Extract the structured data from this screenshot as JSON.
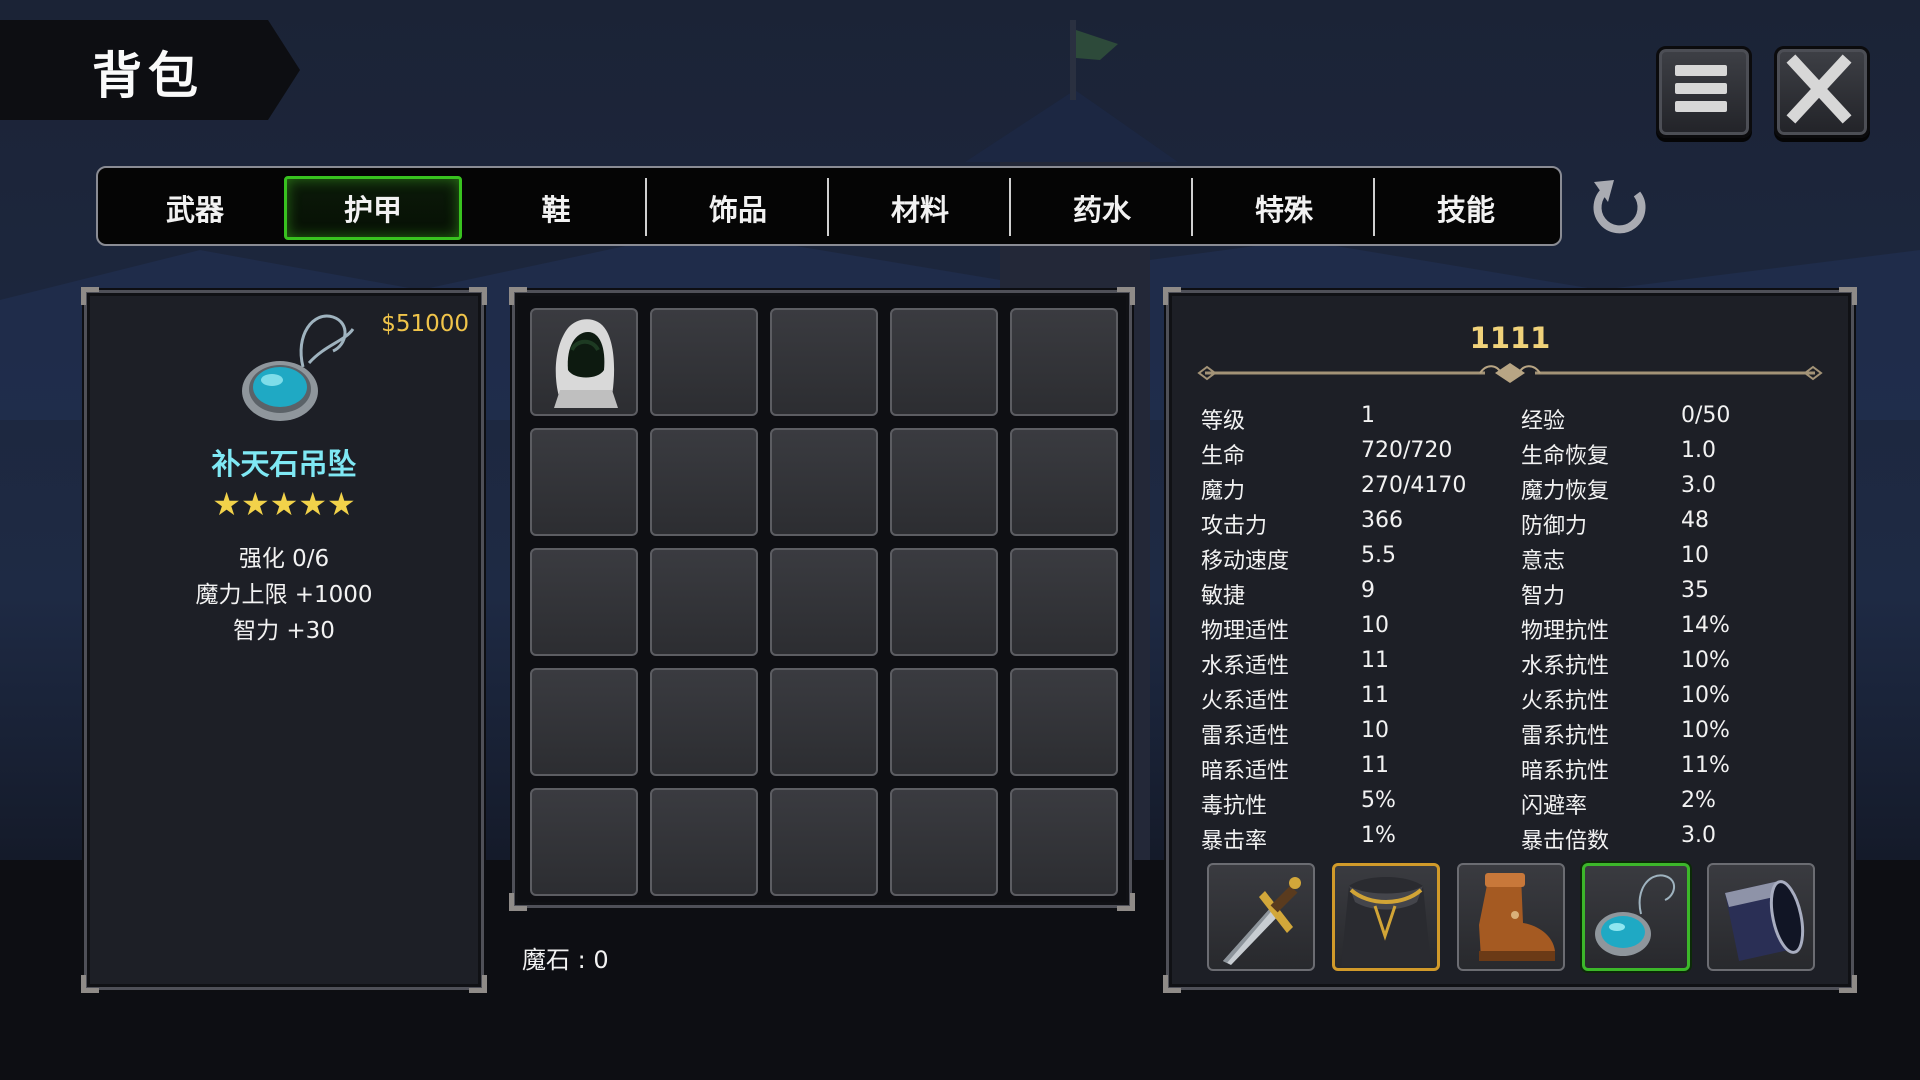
{
  "header": {
    "title": "背包"
  },
  "tabs": [
    {
      "label": "武器",
      "active": false
    },
    {
      "label": "护甲",
      "active": true
    },
    {
      "label": "鞋",
      "active": false
    },
    {
      "label": "饰品",
      "active": false
    },
    {
      "label": "材料",
      "active": false
    },
    {
      "label": "药水",
      "active": false
    },
    {
      "label": "特殊",
      "active": false
    },
    {
      "label": "技能",
      "active": false
    }
  ],
  "selected_item": {
    "price": "$51000",
    "name": "补天石吊坠",
    "stars": "★★★★★",
    "icon": "turquoise-pendant-icon",
    "lines": [
      "强化 0/6",
      "魔力上限  +1000",
      "智力  +30"
    ]
  },
  "inventory": {
    "columns": 5,
    "rows": 5,
    "items": [
      {
        "slot": 0,
        "icon": "white-hood-icon"
      }
    ],
    "magic_stone_label": "魔石 : 0"
  },
  "character": {
    "name": "1111",
    "stats_left": [
      {
        "label": "等级",
        "value": "1"
      },
      {
        "label": "生命",
        "value": "720/720"
      },
      {
        "label": "魔力",
        "value": "270/4170"
      },
      {
        "label": "攻击力",
        "value": "366"
      },
      {
        "label": "移动速度",
        "value": "5.5"
      },
      {
        "label": "敏捷",
        "value": "9"
      },
      {
        "label": "物理适性",
        "value": "10"
      },
      {
        "label": "水系适性",
        "value": "11"
      },
      {
        "label": "火系适性",
        "value": "11"
      },
      {
        "label": "雷系适性",
        "value": "10"
      },
      {
        "label": "暗系适性",
        "value": "11"
      },
      {
        "label": "毒抗性",
        "value": "5%"
      },
      {
        "label": "暴击率",
        "value": "1%"
      }
    ],
    "stats_right": [
      {
        "label": "经验",
        "value": "0/50"
      },
      {
        "label": "生命恢复",
        "value": "1.0"
      },
      {
        "label": "魔力恢复",
        "value": "3.0"
      },
      {
        "label": "防御力",
        "value": "48"
      },
      {
        "label": "意志",
        "value": "10"
      },
      {
        "label": "智力",
        "value": "35"
      },
      {
        "label": "物理抗性",
        "value": "14%"
      },
      {
        "label": "水系抗性",
        "value": "10%"
      },
      {
        "label": "火系抗性",
        "value": "10%"
      },
      {
        "label": "雷系抗性",
        "value": "10%"
      },
      {
        "label": "暗系抗性",
        "value": "11%"
      },
      {
        "label": "闪避率",
        "value": "2%"
      },
      {
        "label": "暴击倍数",
        "value": "3.0"
      }
    ],
    "equipment": [
      {
        "slot": "weapon",
        "icon": "dagger-icon"
      },
      {
        "slot": "armor",
        "icon": "dark-cloak-armor-icon"
      },
      {
        "slot": "shoes",
        "icon": "leather-boot-icon"
      },
      {
        "slot": "accessory",
        "icon": "turquoise-pendant-icon"
      },
      {
        "slot": "special",
        "icon": "dark-scroll-icon"
      }
    ]
  },
  "colors": {
    "tab_active_border": "#38c21f",
    "price": "#f0c44a",
    "item_name": "#7fe8f4",
    "stars": "#f2d24a",
    "character_name": "#f0d27a"
  }
}
